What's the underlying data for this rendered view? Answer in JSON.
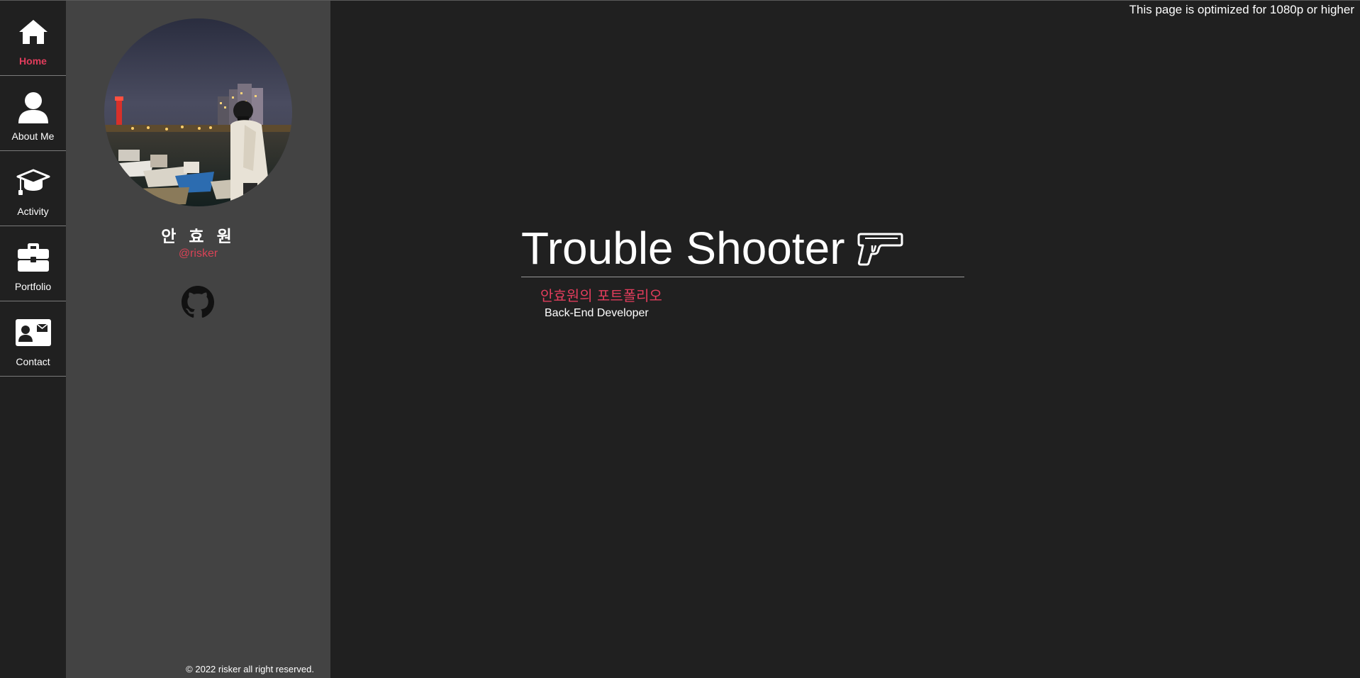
{
  "nav": {
    "items": [
      {
        "label": "Home",
        "icon": "home-icon",
        "active": true
      },
      {
        "label": "About Me",
        "icon": "user-icon",
        "active": false
      },
      {
        "label": "Activity",
        "icon": "graduation-cap-icon",
        "active": false
      },
      {
        "label": "Portfolio",
        "icon": "briefcase-icon",
        "active": false
      },
      {
        "label": "Contact",
        "icon": "contact-card-icon",
        "active": false
      }
    ]
  },
  "profile": {
    "name": "안 효 원",
    "handle": "@risker",
    "github_icon": "github-icon",
    "copyright": "© 2022 risker all right reserved."
  },
  "header": {
    "notice": "This page is optimized for 1080p or higher"
  },
  "hero": {
    "title": "Trouble Shooter",
    "title_icon": "pistol-icon",
    "subtitle": "안효원의 포트폴리오",
    "role": "Back-End Developer"
  },
  "colors": {
    "background": "#202020",
    "panel": "#434343",
    "accent": "#e23d5c",
    "text": "#ffffff"
  }
}
